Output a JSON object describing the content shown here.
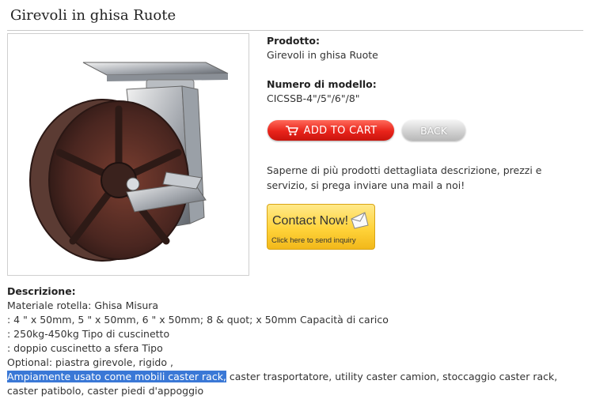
{
  "page": {
    "title": "Girevoli in ghisa Ruote"
  },
  "product": {
    "name_label": "Prodotto:",
    "name_value": "Girevoli in ghisa Ruote",
    "model_label": "Numero di modello:",
    "model_value": "CICSSB-4\"/5\"/6\"/8\""
  },
  "actions": {
    "add_to_cart": "ADD TO CART",
    "back": "BACK"
  },
  "promo": {
    "text": "Saperne di più prodotti dettagliata descrizione, prezzi e servizio, si prega inviare una mail a noi!"
  },
  "contact": {
    "main": "Contact Now!",
    "sub": "Click here to send inquiry"
  },
  "description": {
    "label": "Descrizione:",
    "lines": [
      "Materiale rotella: Ghisa Misura",
      ": 4 \" x 50mm, 5 \" x 50mm, 6 \" x 50mm; 8 & quot; x 50mm Capacità di carico",
      ": 250kg-450kg Tipo di cuscinetto",
      ": doppio cuscinetto a sfera Tipo",
      "Optional: piastra girevole, rigido ,"
    ],
    "highlighted": "Ampiamente usato come mobili caster rack,",
    "rest": " caster trasportatore, utility caster camion, stoccaggio caster rack, caster patibolo, caster piedi d'appoggio"
  },
  "colors": {
    "cart_button": "#e8231a",
    "back_button": "#cfcfcf",
    "contact_button": "#ffd33a",
    "selection_highlight": "#3a78d6"
  },
  "icons": {
    "cart": "cart-icon",
    "contact": "envelope-icon"
  }
}
